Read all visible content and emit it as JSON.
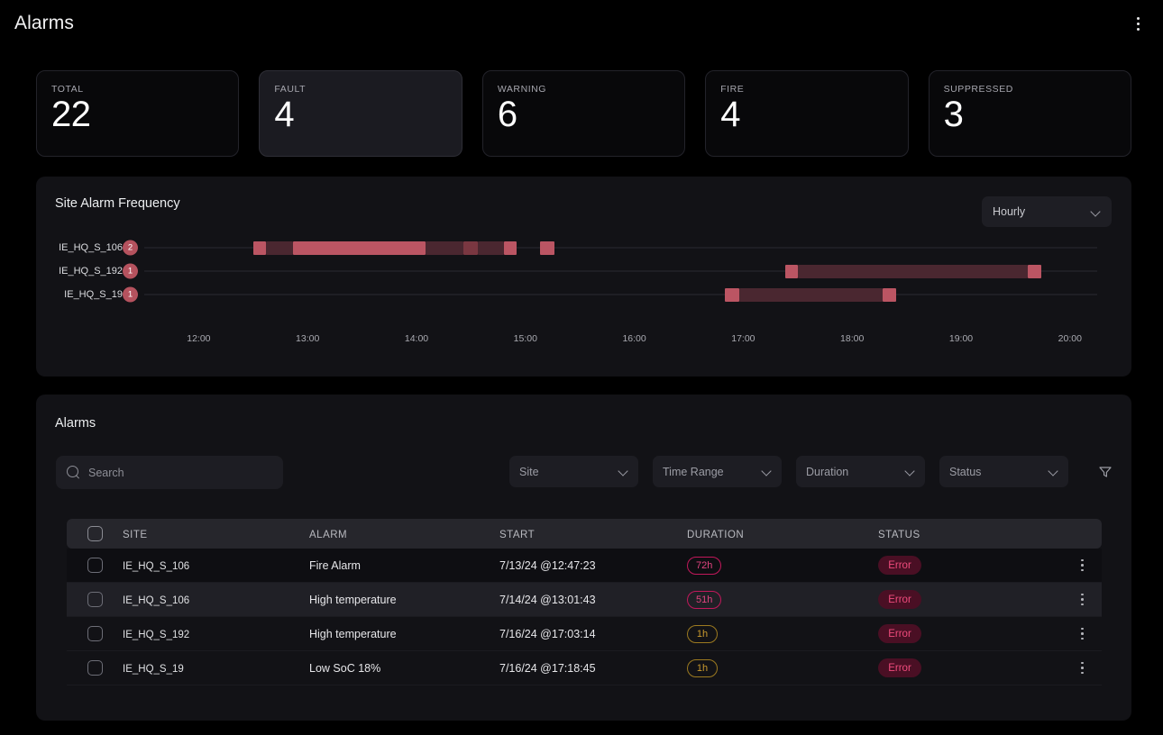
{
  "header": {
    "title": "Alarms",
    "menu_icon": "kebab-menu-icon"
  },
  "stats": [
    {
      "label": "TOTAL",
      "value": "22",
      "active": false
    },
    {
      "label": "FAULT",
      "value": "4",
      "active": true
    },
    {
      "label": "WARNING",
      "value": "6",
      "active": false
    },
    {
      "label": "FIRE",
      "value": "4",
      "active": false
    },
    {
      "label": "SUPPRESSED",
      "value": "3",
      "active": false
    }
  ],
  "chart_panel": {
    "title": "Site Alarm Frequency",
    "granularity": {
      "value": "Hourly",
      "chevron_icon": "chevron-down-icon"
    }
  },
  "chart_data": {
    "type": "bar",
    "title": "Site Alarm Frequency",
    "orientation": "horizontal-timeline",
    "xlabel": "",
    "ylabel": "",
    "grid": true,
    "legend": "none",
    "x_axis": {
      "type": "time",
      "ticks": [
        "12:00",
        "13:00",
        "14:00",
        "15:00",
        "16:00",
        "17:00",
        "18:00",
        "19:00",
        "20:00"
      ],
      "min": "11:30",
      "max": "20:15"
    },
    "categories": [
      "IE_HQ_S_106",
      "IE_HQ_S_192",
      "IE_HQ_S_19"
    ],
    "counts": [
      2,
      1,
      1
    ],
    "series": [
      {
        "name": "IE_HQ_S_106",
        "count": 2,
        "segments": [
          {
            "start": "12:30",
            "end": "12:37",
            "intensity": "high"
          },
          {
            "start": "12:37",
            "end": "12:52",
            "intensity": "low"
          },
          {
            "start": "12:52",
            "end": "14:05",
            "intensity": "high"
          },
          {
            "start": "14:05",
            "end": "14:26",
            "intensity": "low"
          },
          {
            "start": "14:26",
            "end": "14:34",
            "intensity": "medium"
          },
          {
            "start": "14:34",
            "end": "14:48",
            "intensity": "low"
          },
          {
            "start": "14:48",
            "end": "14:55",
            "intensity": "high"
          },
          {
            "start": "15:08",
            "end": "15:16",
            "intensity": "high"
          }
        ]
      },
      {
        "name": "IE_HQ_S_192",
        "count": 1,
        "segments": [
          {
            "start": "17:23",
            "end": "17:30",
            "intensity": "high"
          },
          {
            "start": "17:30",
            "end": "19:37",
            "intensity": "low"
          },
          {
            "start": "19:37",
            "end": "19:44",
            "intensity": "high"
          }
        ]
      },
      {
        "name": "IE_HQ_S_19",
        "count": 1,
        "segments": [
          {
            "start": "16:50",
            "end": "16:58",
            "intensity": "high"
          },
          {
            "start": "16:58",
            "end": "18:17",
            "intensity": "low"
          },
          {
            "start": "18:17",
            "end": "18:24",
            "intensity": "high"
          }
        ]
      }
    ],
    "colors": {
      "high": "#bb5563",
      "medium": "#7a3741",
      "low": "#4a2730",
      "badge": "#b5525e"
    }
  },
  "alarms_panel": {
    "title": "Alarms",
    "search": {
      "placeholder": "Search",
      "value": "",
      "icon": "search-icon"
    },
    "filters": [
      {
        "label": "Site",
        "name": "site"
      },
      {
        "label": "Time Range",
        "name": "time-range"
      },
      {
        "label": "Duration",
        "name": "duration"
      },
      {
        "label": "Status",
        "name": "status"
      }
    ],
    "filter_icon": "filter-funnel-icon",
    "columns": [
      "SITE",
      "ALARM",
      "START",
      "DURATION",
      "STATUS"
    ],
    "rows": [
      {
        "site": "IE_HQ_S_106",
        "alarm": "Fire Alarm",
        "start": "7/13/24 @12:47:23",
        "duration": "72h",
        "duration_level": "crimson",
        "status": "Error",
        "selected": false
      },
      {
        "site": "IE_HQ_S_106",
        "alarm": "High temperature",
        "start": "7/14/24 @13:01:43",
        "duration": "51h",
        "duration_level": "crimson",
        "status": "Error",
        "selected": false
      },
      {
        "site": "IE_HQ_S_192",
        "alarm": "High temperature",
        "start": "7/16/24 @17:03:14",
        "duration": "1h",
        "duration_level": "amber",
        "status": "Error",
        "selected": false
      },
      {
        "site": "IE_HQ_S_19",
        "alarm": "Low SoC 18%",
        "start": "7/16/24 @17:18:45",
        "duration": "1h",
        "duration_level": "amber",
        "status": "Error",
        "selected": false
      }
    ]
  },
  "theme": {
    "background": "#000000",
    "panel": "#121216",
    "accent": "#bb5563",
    "error_text": "#ef4b7c",
    "error_bg": "#4a0f24",
    "amber": "#c99a2e"
  }
}
